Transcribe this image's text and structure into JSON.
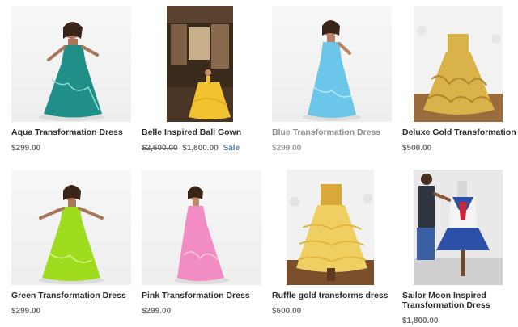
{
  "products": [
    {
      "title": "Aqua Transformation Dress",
      "price": "$299.00",
      "compare_at": "",
      "sale_label": "",
      "dress_color": "#1f8f88"
    },
    {
      "title": "Belle Inspired Ball Gown",
      "price": "$1,800.00",
      "compare_at": "$2,600.00",
      "sale_label": "Sale",
      "dress_color": "#f2c230"
    },
    {
      "title": "Blue Transformation Dress",
      "price": "$299.00",
      "compare_at": "",
      "sale_label": "",
      "dress_color": "#6cc6ea"
    },
    {
      "title": "Deluxe Gold Transformation",
      "price": "$500.00",
      "compare_at": "",
      "sale_label": "",
      "dress_color": "#d9b24a"
    },
    {
      "title": "Green Transformation Dress",
      "price": "$299.00",
      "compare_at": "",
      "sale_label": "",
      "dress_color": "#9fdc1e"
    },
    {
      "title": "Pink Transformation Dress",
      "price": "$299.00",
      "compare_at": "",
      "sale_label": "",
      "dress_color": "#f28cc4"
    },
    {
      "title": "Ruffle gold transforms dress",
      "price": "$600.00",
      "compare_at": "",
      "sale_label": "",
      "dress_color": "#f0cf62"
    },
    {
      "title": "Sailor Moon Inspired Transformation Dress",
      "title_line1": "Sailor Moon Inspired",
      "title_line2": "Transformation Dress",
      "price": "$1,800.00",
      "compare_at": "",
      "sale_label": "",
      "dress_color": "#2d4fa8"
    }
  ]
}
